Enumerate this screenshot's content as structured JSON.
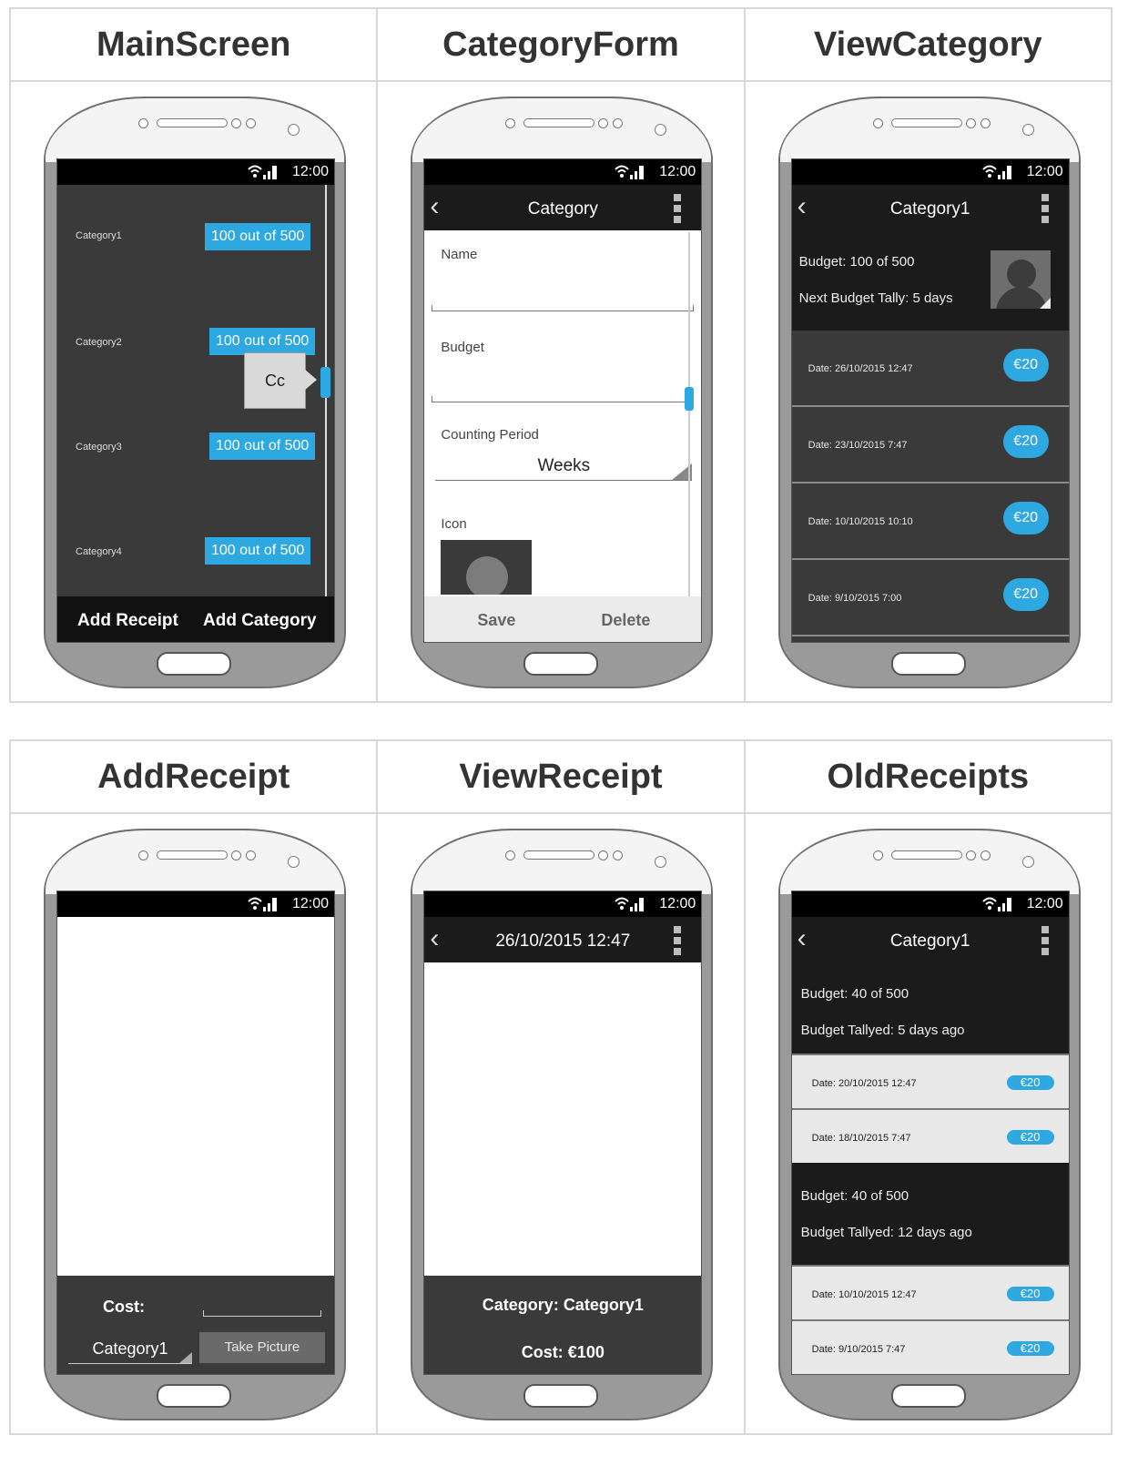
{
  "headers": [
    "MainScreen",
    "CategoryForm",
    "ViewCategory",
    "AddReceipt",
    "ViewReceipt",
    "OldReceipts"
  ],
  "status_time": "12:00",
  "main_screen": {
    "rows": [
      {
        "label": "Category1",
        "value": "100 out of 500"
      },
      {
        "label": "Category2",
        "value": "100 out of 500"
      },
      {
        "label": "Category3",
        "value": "100 out of 500"
      },
      {
        "label": "Category4",
        "value": "100 out of 500"
      }
    ],
    "tooltip": "Cc",
    "add_receipt": "Add Receipt",
    "add_category": "Add Category"
  },
  "category_form": {
    "title": "Category",
    "name_label": "Name",
    "budget_label": "Budget",
    "period_label": "Counting Period",
    "period_value": "Weeks",
    "icon_label": "Icon",
    "save": "Save",
    "delete": "Delete"
  },
  "view_category": {
    "title": "Category1",
    "budget": "Budget: 100 of 500",
    "next_tally": "Next Budget Tally: 5 days",
    "rows": [
      {
        "date": "Date: 26/10/2015 12:47",
        "amount": "€20"
      },
      {
        "date": "Date: 23/10/2015 7:47",
        "amount": "€20"
      },
      {
        "date": "Date: 10/10/2015 10:10",
        "amount": "€20"
      },
      {
        "date": "Date: 9/10/2015 7:00",
        "amount": "€20"
      }
    ]
  },
  "add_receipt": {
    "cost_label": "Cost:",
    "category_value": "Category1",
    "take_picture": "Take Picture"
  },
  "view_receipt": {
    "title": "26/10/2015 12:47",
    "category": "Category: Category1",
    "cost": "Cost: €100"
  },
  "old_receipts": {
    "title": "Category1",
    "groups": [
      {
        "budget": "Budget: 40 of 500",
        "tallied": "Budget Tallyed: 5 days ago",
        "rows": [
          {
            "date": "Date: 20/10/2015 12:47",
            "amount": "€20"
          },
          {
            "date": "Date: 18/10/2015 7:47",
            "amount": "€20"
          }
        ]
      },
      {
        "budget": "Budget: 40 of 500",
        "tallied": "Budget Tallyed: 12 days ago",
        "rows": [
          {
            "date": "Date: 10/10/2015 12:47",
            "amount": "€20"
          },
          {
            "date": "Date: 9/10/2015 7:47",
            "amount": "€20"
          }
        ]
      }
    ]
  }
}
